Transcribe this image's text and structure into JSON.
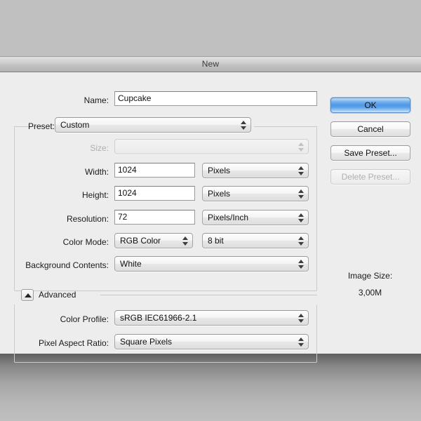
{
  "window": {
    "title": "New"
  },
  "fields": {
    "name": {
      "label": "Name:",
      "value": "Cupcake",
      "placeholder": "Untitled-1"
    },
    "preset": {
      "label": "Preset:",
      "value": "Custom"
    },
    "size": {
      "label": "Size:",
      "value": "",
      "enabled": false
    },
    "width": {
      "label": "Width:",
      "value": "1024",
      "unit": "Pixels"
    },
    "height": {
      "label": "Height:",
      "value": "1024",
      "unit": "Pixels"
    },
    "resolution": {
      "label": "Resolution:",
      "value": "72",
      "unit": "Pixels/Inch"
    },
    "color_mode": {
      "label": "Color Mode:",
      "value": "RGB Color",
      "depth": "8 bit"
    },
    "background_contents": {
      "label": "Background Contents:",
      "value": "White"
    }
  },
  "advanced": {
    "label": "Advanced",
    "expanded": true,
    "color_profile": {
      "label": "Color Profile:",
      "value": "sRGB IEC61966-2.1"
    },
    "pixel_aspect_ratio": {
      "label": "Pixel Aspect Ratio:",
      "value": "Square Pixels"
    }
  },
  "buttons": {
    "ok": "OK",
    "cancel": "Cancel",
    "save_preset": "Save Preset...",
    "delete_preset": "Delete Preset..."
  },
  "image_size": {
    "label": "Image Size:",
    "value": "3,00M"
  },
  "colors": {
    "accent": "#4f97e6",
    "dialog_bg": "#ededed",
    "desktop_bg": "#bfbfbf",
    "text": "#1a1a1a",
    "disabled_text": "#b0b0b0"
  }
}
